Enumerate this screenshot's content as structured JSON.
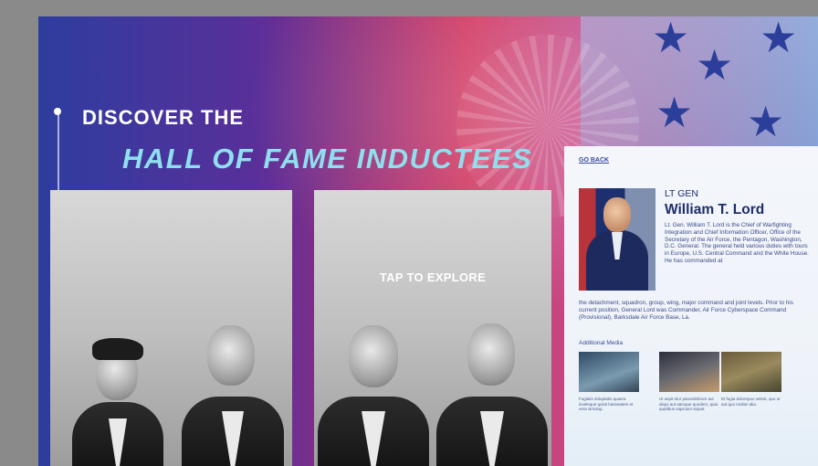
{
  "heading": {
    "line1": "DISCOVER THE",
    "line2": "HALL OF FAME INDUCTEES"
  },
  "card2": {
    "cta": "TAP TO EXPLORE"
  },
  "detail": {
    "back_link": "GO BACK",
    "rank": "LT GEN",
    "name": "William T. Lord",
    "bio_part1": "Lt. Gen. William T. Lord is the Chief of Warfighting Integration and Chief Information Officer, Office of the Secretary of the Air Force, the Pentagon, Washington, D.C. General. The general held various duties with tours in Europe, U.S. Central Command and the White House. He has commanded at",
    "bio_part2": "the detachment, squadron, group, wing, major command and joint levels. Prior to his current position, General Lord was Commander, Air Force Cyberspace Command (Provisional), Barksdale Air Force Base, La.",
    "media_heading": "Additional Media",
    "media": [
      {
        "caption": "Fugiatis doluptatis quaera inveleque quisit hasseatem et vera simolup."
      },
      {
        "caption": "Ut aspit etur parundebrum aut aliqui aut aamque quodem, quia quatibus sapicium siquat."
      },
      {
        "caption": "Et fugia dolorepuo velest, quo ut aut quo mollari alia."
      }
    ]
  },
  "colors": {
    "headline_accent": "#8fe0ef",
    "panel_text": "#1e2d6a"
  }
}
